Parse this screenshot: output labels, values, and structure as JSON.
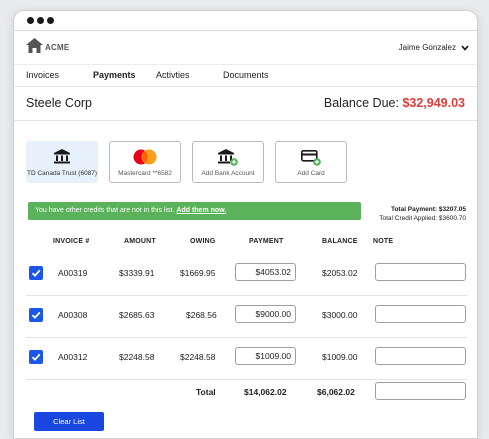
{
  "header": {
    "logo_text": "ACME",
    "user_name": "Jaime Gonzalez"
  },
  "nav": {
    "items": [
      {
        "label": "Invoices"
      },
      {
        "label": "Payments"
      },
      {
        "label": "Activties"
      },
      {
        "label": "Documents"
      }
    ],
    "active": "Payments"
  },
  "company": {
    "name": "Steele Corp",
    "balance_label": "Balance Due:",
    "balance_amount": "$32,949.03"
  },
  "payment_methods": [
    {
      "label": "TD Canada Trust (6087)",
      "icon": "bank-icon",
      "selected": true
    },
    {
      "label": "Mastercard **6582",
      "icon": "mastercard-icon",
      "selected": false
    },
    {
      "label": "Add Bank Account",
      "icon": "add-bank-icon",
      "selected": false
    },
    {
      "label": "Add Card",
      "icon": "add-card-icon",
      "selected": false
    }
  ],
  "credits": {
    "message": "You have other credits that are not in this list.",
    "link": "Add them now."
  },
  "totals": {
    "payment_label": "Total Payment:",
    "payment_value": "$3207.05",
    "credit_label": "Total Credit Applied:",
    "credit_value": "$3600.70"
  },
  "table": {
    "headers": [
      "INVOICE #",
      "AMOUNT",
      "OWING",
      "PAYMENT",
      "BALANCE",
      "NOTE"
    ],
    "rows": [
      {
        "checked": true,
        "invoice": "A00319",
        "amount": "$3339.91",
        "owing": "$1669.95",
        "payment": "$4053.02",
        "balance": "$2053.02",
        "note": ""
      },
      {
        "checked": true,
        "invoice": "A00308",
        "amount": "$2685.63",
        "owing": "$268.56",
        "payment": "$9000.00",
        "balance": "$3000.00",
        "note": ""
      },
      {
        "checked": true,
        "invoice": "A00312",
        "amount": "$2248.58",
        "owing": "$2248.58",
        "payment": "$1009.00",
        "balance": "$1009.00",
        "note": ""
      }
    ],
    "total_label": "Total",
    "total_payment": "$14,062.02",
    "total_balance": "$6,062.02"
  },
  "actions": {
    "clear_label": "Clear List"
  },
  "colors": {
    "accent_blue": "#1a47e0",
    "checkbox_blue": "#1a56e8",
    "success_green": "#5ab25a",
    "balance_red": "#e23b3b",
    "selected_method_bg": "#e6f1fb"
  }
}
